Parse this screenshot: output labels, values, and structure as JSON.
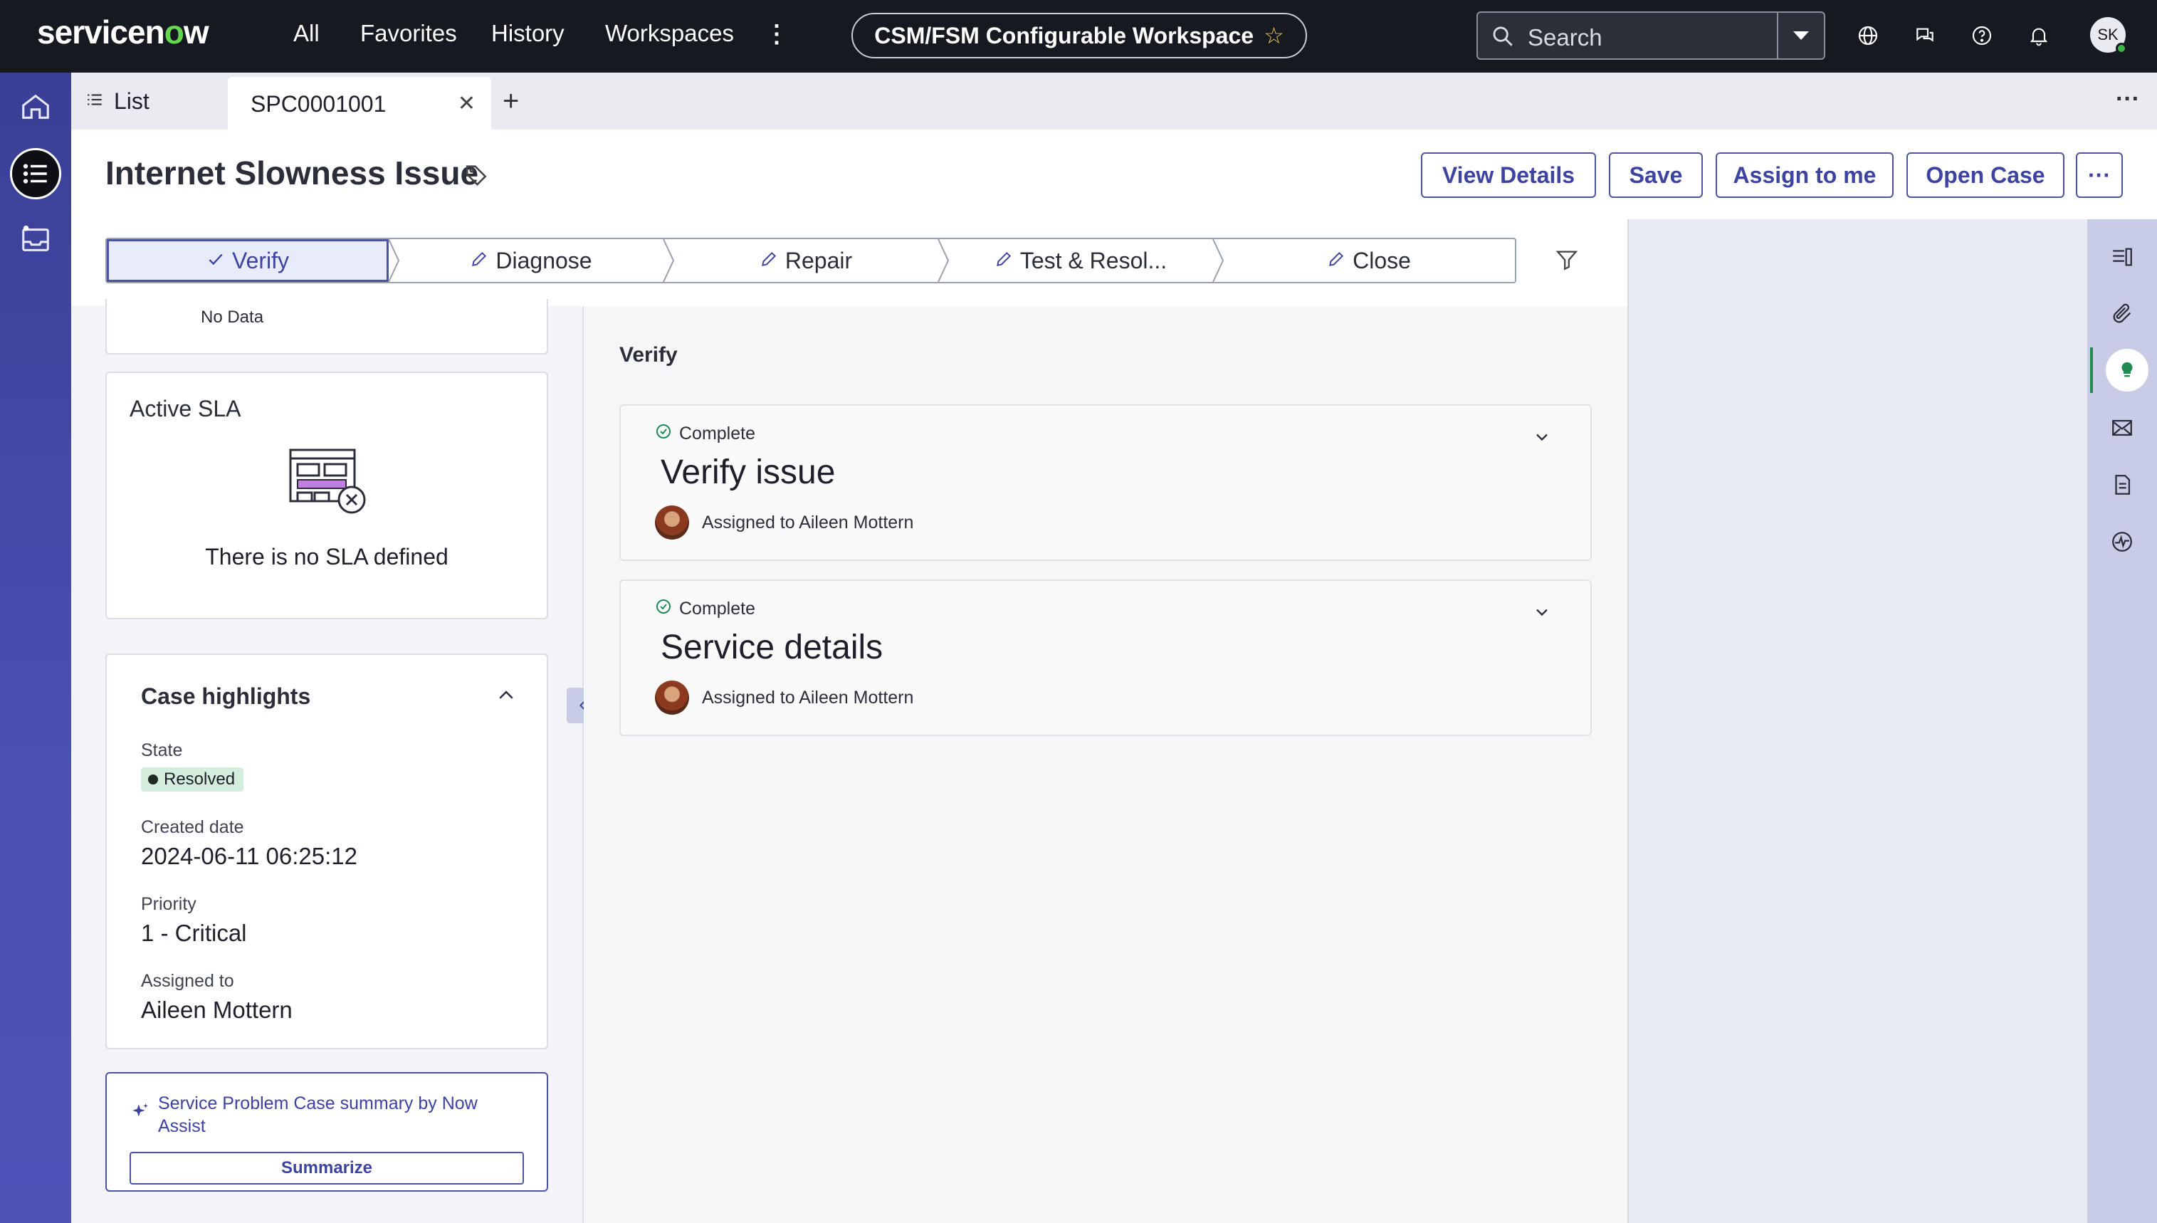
{
  "topnav": {
    "logo_before": "servicen",
    "logo_o": "o",
    "logo_after": "w",
    "links": [
      "All",
      "Favorites",
      "History",
      "Workspaces"
    ],
    "workspace_title": "CSM/FSM Configurable Workspace",
    "search_placeholder": "Search",
    "avatar_initials": "SK"
  },
  "tabs": {
    "list_label": "List",
    "active_label": "SPC0001001"
  },
  "header": {
    "title": "Internet Slowness Issue",
    "buttons": [
      "View Details",
      "Save",
      "Assign to me",
      "Open Case"
    ]
  },
  "stages": [
    {
      "label": "Verify",
      "state": "done"
    },
    {
      "label": "Diagnose",
      "state": "edit"
    },
    {
      "label": "Repair",
      "state": "edit"
    },
    {
      "label": "Test & Resol...",
      "state": "edit"
    },
    {
      "label": "Close",
      "state": "edit"
    }
  ],
  "left": {
    "nodata": "No Data",
    "sla_title": "Active SLA",
    "sla_empty": "There is no SLA defined",
    "highlights_title": "Case highlights",
    "state_label": "State",
    "state_value": "Resolved",
    "created_label": "Created date",
    "created_value": "2024-06-11 06:25:12",
    "priority_label": "Priority",
    "priority_value": "1 - Critical",
    "assigned_label": "Assigned to",
    "assigned_value": "Aileen Mottern",
    "assist_link": "Service Problem Case summary by Now Assist",
    "summarize_label": "Summarize"
  },
  "main": {
    "section_title": "Verify",
    "tasks": [
      {
        "status": "Complete",
        "title": "Verify issue",
        "assigned": "Assigned to Aileen Mottern"
      },
      {
        "status": "Complete",
        "title": "Service details",
        "assigned": "Assigned to Aileen Mottern"
      }
    ]
  },
  "colors": {
    "nav_bg": "#16191f",
    "accent": "#4d53a3",
    "rail": "#4b4fb3",
    "resolved_badge": "#d4eedd",
    "agent_assist_active": "#1f8a52"
  },
  "icons": {
    "rail": [
      "home-icon",
      "list-icon",
      "inbox-icon"
    ],
    "right_rail": [
      "details-panel-icon",
      "attachment-icon",
      "agent-assist-icon",
      "email-icon",
      "document-icon",
      "activity-icon"
    ]
  }
}
